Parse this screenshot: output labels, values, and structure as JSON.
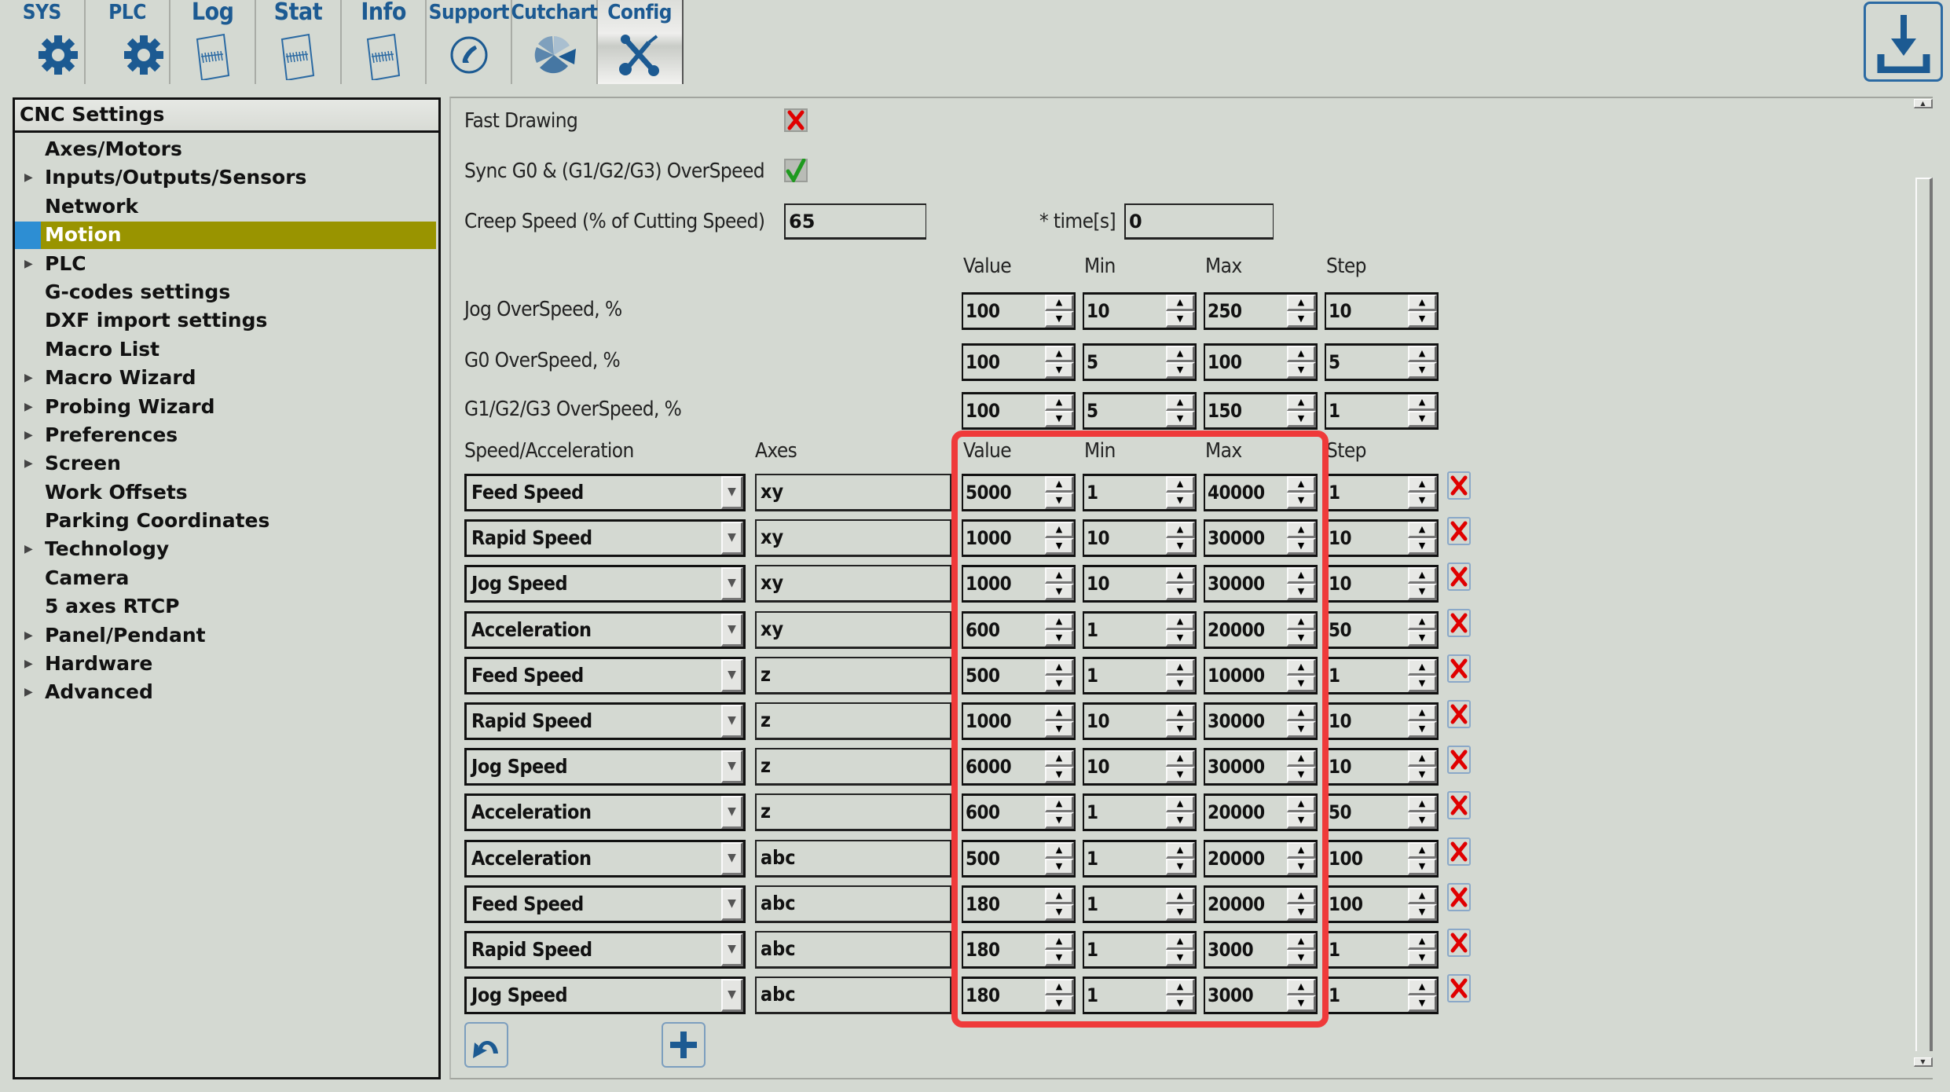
{
  "tabs": [
    {
      "label": "SYS",
      "icon": "gear-icon"
    },
    {
      "label": "PLC",
      "icon": "gear-icon"
    },
    {
      "label": "Log",
      "icon": "document-icon"
    },
    {
      "label": "Stat",
      "icon": "document-icon"
    },
    {
      "label": "Info",
      "icon": "document-icon"
    },
    {
      "label": "Support",
      "icon": "phone-icon"
    },
    {
      "label": "Cutchart",
      "icon": "pie-chart-icon"
    },
    {
      "label": "Config",
      "icon": "tools-icon",
      "active": true
    }
  ],
  "download_button": {
    "icon": "download-icon"
  },
  "sidebar": {
    "title": "CNC Settings",
    "items": [
      {
        "label": "Axes/Motors",
        "expandable": false
      },
      {
        "label": "Inputs/Outputs/Sensors",
        "expandable": true
      },
      {
        "label": "Network",
        "expandable": false
      },
      {
        "label": "Motion",
        "expandable": false,
        "selected": true
      },
      {
        "label": "PLC",
        "expandable": true
      },
      {
        "label": "G-codes settings",
        "expandable": false
      },
      {
        "label": "DXF import settings",
        "expandable": false
      },
      {
        "label": "Macro List",
        "expandable": false
      },
      {
        "label": "Macro Wizard",
        "expandable": true
      },
      {
        "label": "Probing Wizard",
        "expandable": true
      },
      {
        "label": "Preferences",
        "expandable": true
      },
      {
        "label": "Screen",
        "expandable": true
      },
      {
        "label": "Work Offsets",
        "expandable": false
      },
      {
        "label": "Parking Coordinates",
        "expandable": false
      },
      {
        "label": "Technology",
        "expandable": true
      },
      {
        "label": "Camera",
        "expandable": false
      },
      {
        "label": "5 axes RTCP",
        "expandable": false
      },
      {
        "label": "Panel/Pendant",
        "expandable": true
      },
      {
        "label": "Hardware",
        "expandable": true
      },
      {
        "label": "Advanced",
        "expandable": true
      }
    ]
  },
  "motion": {
    "fast_drawing": {
      "label": "Fast Drawing",
      "checked": false
    },
    "sync_overspeed": {
      "label": "Sync G0 & (G1/G2/G3) OverSpeed",
      "checked": true
    },
    "creep_speed": {
      "label": "Creep Speed (% of Cutting Speed)",
      "value": "65",
      "time_label": "* time[s]",
      "time_value": "0"
    },
    "columns": {
      "value": "Value",
      "min": "Min",
      "max": "Max",
      "step": "Step"
    },
    "overspeeds": [
      {
        "label": "Jog OverSpeed, %",
        "value": "100",
        "min": "10",
        "max": "250",
        "step": "10"
      },
      {
        "label": "G0 OverSpeed, %",
        "value": "100",
        "min": "5",
        "max": "100",
        "step": "5"
      },
      {
        "label": "G1/G2/G3 OverSpeed, %",
        "value": "100",
        "min": "5",
        "max": "150",
        "step": "1"
      }
    ],
    "table_headers": {
      "type": "Speed/Acceleration",
      "axes": "Axes",
      "value": "Value",
      "min": "Min",
      "max": "Max",
      "step": "Step"
    },
    "rows": [
      {
        "type": "Feed Speed",
        "axes": "xy",
        "value": "5000",
        "min": "1",
        "max": "40000",
        "step": "1"
      },
      {
        "type": "Rapid Speed",
        "axes": "xy",
        "value": "1000",
        "min": "10",
        "max": "30000",
        "step": "10"
      },
      {
        "type": "Jog Speed",
        "axes": "xy",
        "value": "1000",
        "min": "10",
        "max": "30000",
        "step": "10"
      },
      {
        "type": "Acceleration",
        "axes": "xy",
        "value": "600",
        "min": "1",
        "max": "20000",
        "step": "50"
      },
      {
        "type": "Feed Speed",
        "axes": "z",
        "value": "500",
        "min": "1",
        "max": "10000",
        "step": "1"
      },
      {
        "type": "Rapid Speed",
        "axes": "z",
        "value": "1000",
        "min": "10",
        "max": "30000",
        "step": "10"
      },
      {
        "type": "Jog Speed",
        "axes": "z",
        "value": "6000",
        "min": "10",
        "max": "30000",
        "step": "10"
      },
      {
        "type": "Acceleration",
        "axes": "z",
        "value": "600",
        "min": "1",
        "max": "20000",
        "step": "50"
      },
      {
        "type": "Acceleration",
        "axes": "abc",
        "value": "500",
        "min": "1",
        "max": "20000",
        "step": "100"
      },
      {
        "type": "Feed Speed",
        "axes": "abc",
        "value": "180",
        "min": "1",
        "max": "20000",
        "step": "100"
      },
      {
        "type": "Rapid Speed",
        "axes": "abc",
        "value": "180",
        "min": "1",
        "max": "3000",
        "step": "1"
      },
      {
        "type": "Jog Speed",
        "axes": "abc",
        "value": "180",
        "min": "1",
        "max": "3000",
        "step": "1"
      }
    ],
    "undo_button": {
      "icon": "undo-icon"
    },
    "add_button": {
      "icon": "plus-icon"
    }
  },
  "colors": {
    "accent_blue": "#1c5a92",
    "selected_item_bg": "#999400",
    "selected_marker": "#2d8ed3",
    "highlight_box": "#ef3a3a",
    "delete_red": "#e00000",
    "check_green": "#1f9a1f"
  }
}
